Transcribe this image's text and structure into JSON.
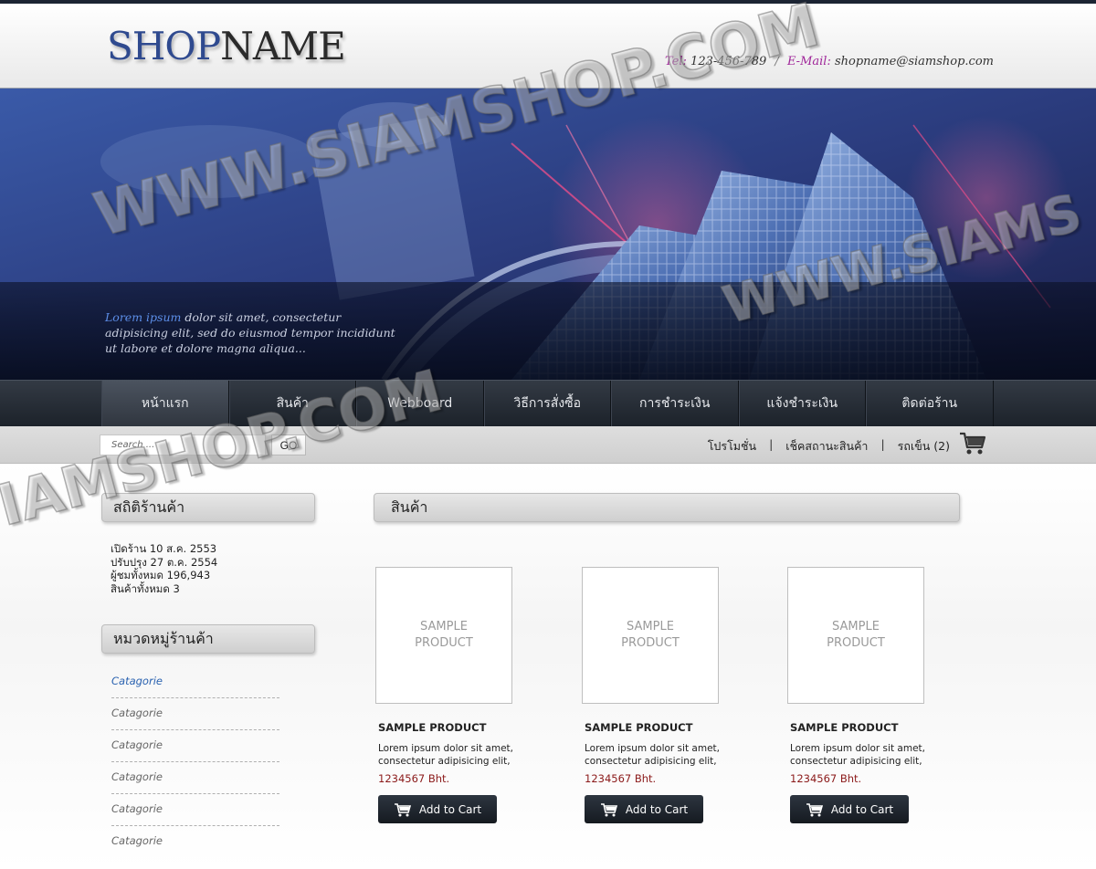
{
  "header": {
    "logo_shop": "SHOP",
    "logo_name": "NAME",
    "tel_label": "Tel:",
    "tel_value": "123-456-789",
    "separator": "/",
    "email_label": "E-Mail:",
    "email_value": "shopname@siamshop.com"
  },
  "banner": {
    "text_highlight": "Lorem ipsum",
    "text_rest": " dolor sit amet, consectetur adipisicing elit, sed do eiusmod tempor incididunt ut labore et dolore magna aliqua..."
  },
  "nav": {
    "items": [
      {
        "label": "หน้าแรก"
      },
      {
        "label": "สินค้า"
      },
      {
        "label": "Webboard"
      },
      {
        "label": "วิธีการสั่งซื้อ"
      },
      {
        "label": "การชำระเงิน"
      },
      {
        "label": "แจ้งชำระเงิน"
      },
      {
        "label": "ติดต่อร้าน"
      }
    ]
  },
  "toolbar": {
    "search_placeholder": "Search ...",
    "go_label": "GO",
    "promo_label": "โปรโมชั่น",
    "track_label": "เช็คสถานะสินค้า",
    "cart_label": "รถเข็น (2)",
    "sep": "|"
  },
  "sidebar": {
    "stats_title": "สถิติร้านค้า",
    "stats": [
      "เปิดร้าน 10 ส.ค. 2553",
      "ปรับปรุง 27 ต.ค. 2554",
      "ผู้ชมทั้งหมด 196,943",
      "สินค้าทั้งหมด 3"
    ],
    "categories_title": "หมวดหมู่ร้านค้า",
    "categories": [
      "Catagorie",
      "Catagorie",
      "Catagorie",
      "Catagorie",
      "Catagorie",
      "Catagorie"
    ]
  },
  "main": {
    "title": "สินค้า",
    "products": [
      {
        "thumb_line1": "SAMPLE",
        "thumb_line2": "PRODUCT",
        "name": "SAMPLE PRODUCT",
        "desc": "Lorem ipsum dolor sit amet, consectetur adipisicing elit,",
        "price": "1234567 Bht.",
        "button": "Add to Cart"
      },
      {
        "thumb_line1": "SAMPLE",
        "thumb_line2": "PRODUCT",
        "name": "SAMPLE PRODUCT",
        "desc": "Lorem ipsum dolor sit amet, consectetur adipisicing elit,",
        "price": "1234567 Bht.",
        "button": "Add to Cart"
      },
      {
        "thumb_line1": "SAMPLE",
        "thumb_line2": "PRODUCT",
        "name": "SAMPLE PRODUCT",
        "desc": "Lorem ipsum dolor sit amet, consectetur adipisicing elit,",
        "price": "1234567 Bht.",
        "button": "Add to Cart"
      }
    ]
  },
  "watermark": {
    "text_a": "WWW.SIAMSHOP.COM",
    "text_b": "IAMSHOP.COM",
    "text_c": "WWW.SIAMS"
  },
  "colors": {
    "logo_blue": "#2f4a8f",
    "contact_label": "#a0279a",
    "price": "#8b1a1a",
    "category_link": "#2a62b0",
    "nav_bg": "#262c34"
  }
}
